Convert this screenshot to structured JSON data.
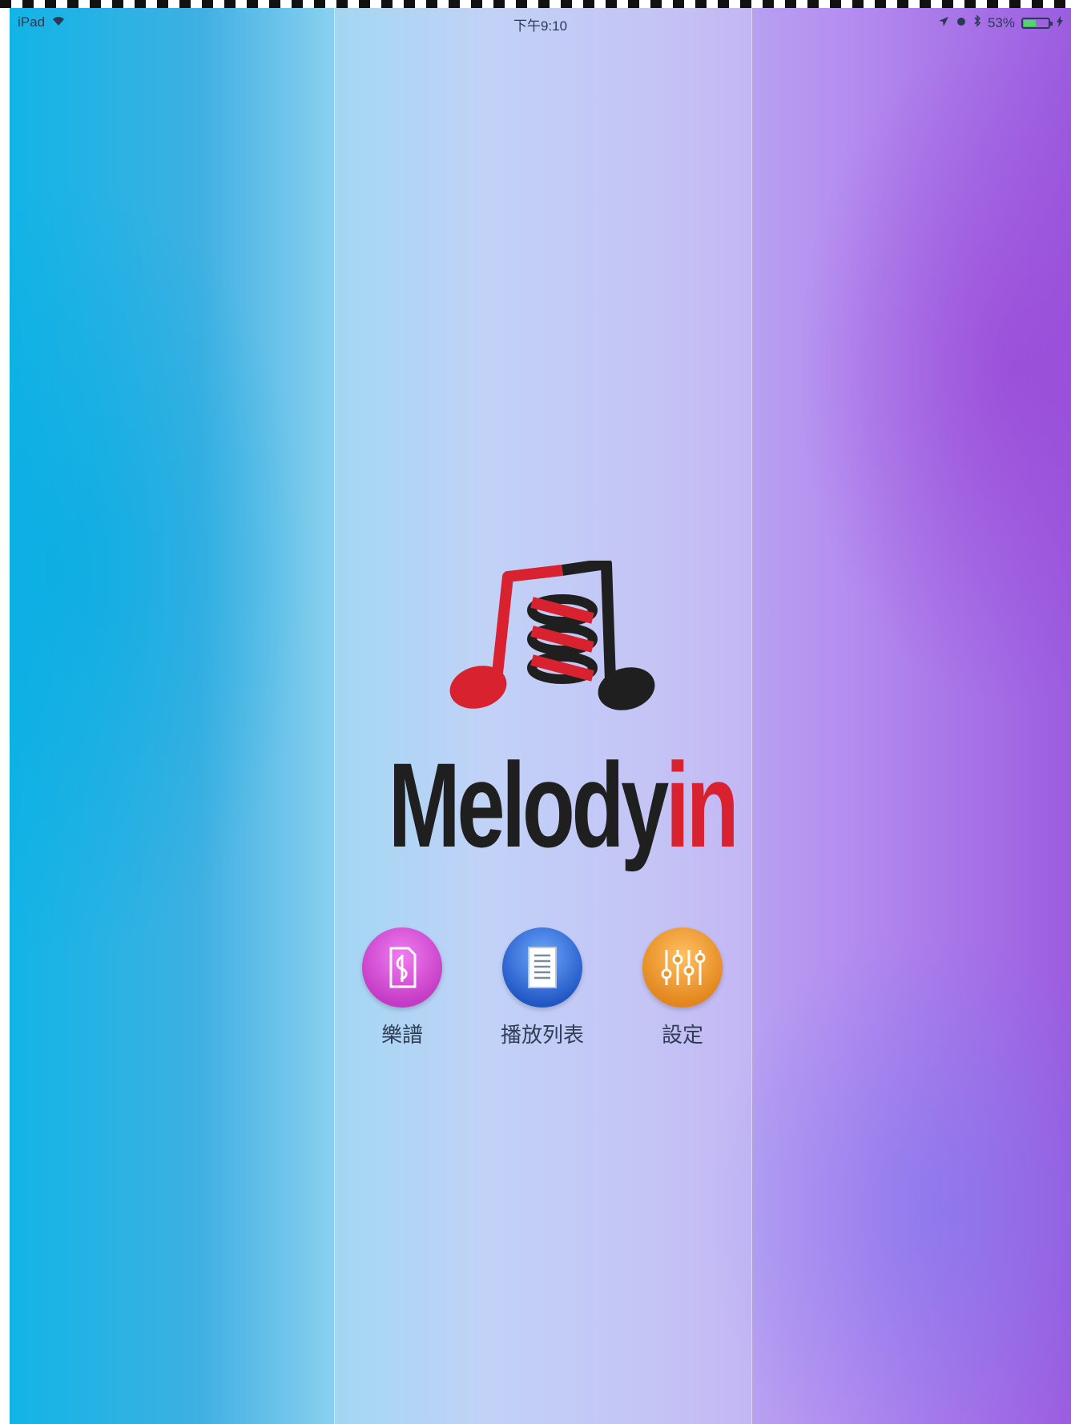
{
  "status_bar": {
    "device": "iPad",
    "time": "下午9:10",
    "battery_percent": "53%",
    "battery_level": 0.53
  },
  "logo": {
    "text_main": "Melody",
    "text_accent": "in",
    "color_dark": "#1f1f1f",
    "color_accent": "#d8222f"
  },
  "menu": {
    "items": [
      {
        "label": "樂譜",
        "icon": "music-score-icon",
        "color": "#d94fd6"
      },
      {
        "label": "播放列表",
        "icon": "playlist-icon",
        "color": "#3b78d8"
      },
      {
        "label": "設定",
        "icon": "settings-sliders-icon",
        "color": "#e8952a"
      }
    ]
  }
}
